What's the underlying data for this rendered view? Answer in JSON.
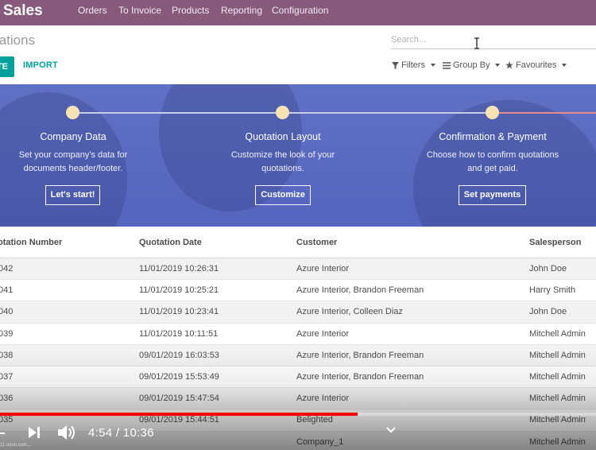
{
  "app": {
    "title": "Sales"
  },
  "menu": [
    "Orders",
    "To Invoice",
    "Products",
    "Reporting",
    "Configuration"
  ],
  "breadcrumb": "tations",
  "search": {
    "placeholder": "Search..."
  },
  "actions": {
    "create": "TE",
    "import": "IMPORT"
  },
  "filters": {
    "filters": "Filters",
    "group_by": "Group By",
    "favourites": "Favourites"
  },
  "onboarding": {
    "steps": [
      {
        "title": "Company Data",
        "desc_line1": "Set your company's data for",
        "desc_line2": "documents header/footer.",
        "button": "Let's start!"
      },
      {
        "title": "Quotation Layout",
        "desc_line1": "Customize the look of your",
        "desc_line2": "quotations.",
        "button": "Customize"
      },
      {
        "title": "Confirmation & Payment",
        "desc_line1": "Choose how to confirm quotations",
        "desc_line2": "and get paid.",
        "button": "Set payments"
      }
    ]
  },
  "table": {
    "headers": [
      "otation Number",
      "Quotation Date",
      "Customer",
      "Salesperson"
    ],
    "rows": [
      [
        "042",
        "11/01/2019 10:26:31",
        "Azure Interior",
        "John Doe"
      ],
      [
        "041",
        "11/01/2019 10:25:21",
        "Azure Interior, Brandon Freeman",
        "Harry Smith"
      ],
      [
        "040",
        "11/01/2019 10:23:41",
        "Azure Interior, Colleen Diaz",
        "John Doe"
      ],
      [
        "039",
        "11/01/2019 10:11:51",
        "Azure Interior",
        "Mitchell Admin"
      ],
      [
        "038",
        "09/01/2019 16:03:53",
        "Azure Interior, Brandon Freeman",
        "Mitchell Admin"
      ],
      [
        "037",
        "09/01/2019 15:53:49",
        "Azure Interior, Brandon Freeman",
        "Mitchell Admin"
      ],
      [
        "036",
        "09/01/2019 15:47:54",
        "Azure Interior",
        "Mitchell Admin"
      ],
      [
        "035",
        "09/01/2019 15:44:51",
        "Belighted",
        "Mitchell Admin"
      ],
      [
        "",
        "",
        "Company_1",
        "Mitchell Admin"
      ]
    ]
  },
  "video": {
    "time": "4:54 / 10:36",
    "progress": 0.6,
    "url": "11.odoo.com..."
  },
  "colors": {
    "nav": "#875a7b",
    "accent": "#00a09d",
    "banner": "#5f70c4",
    "progress": "#ff0000"
  }
}
